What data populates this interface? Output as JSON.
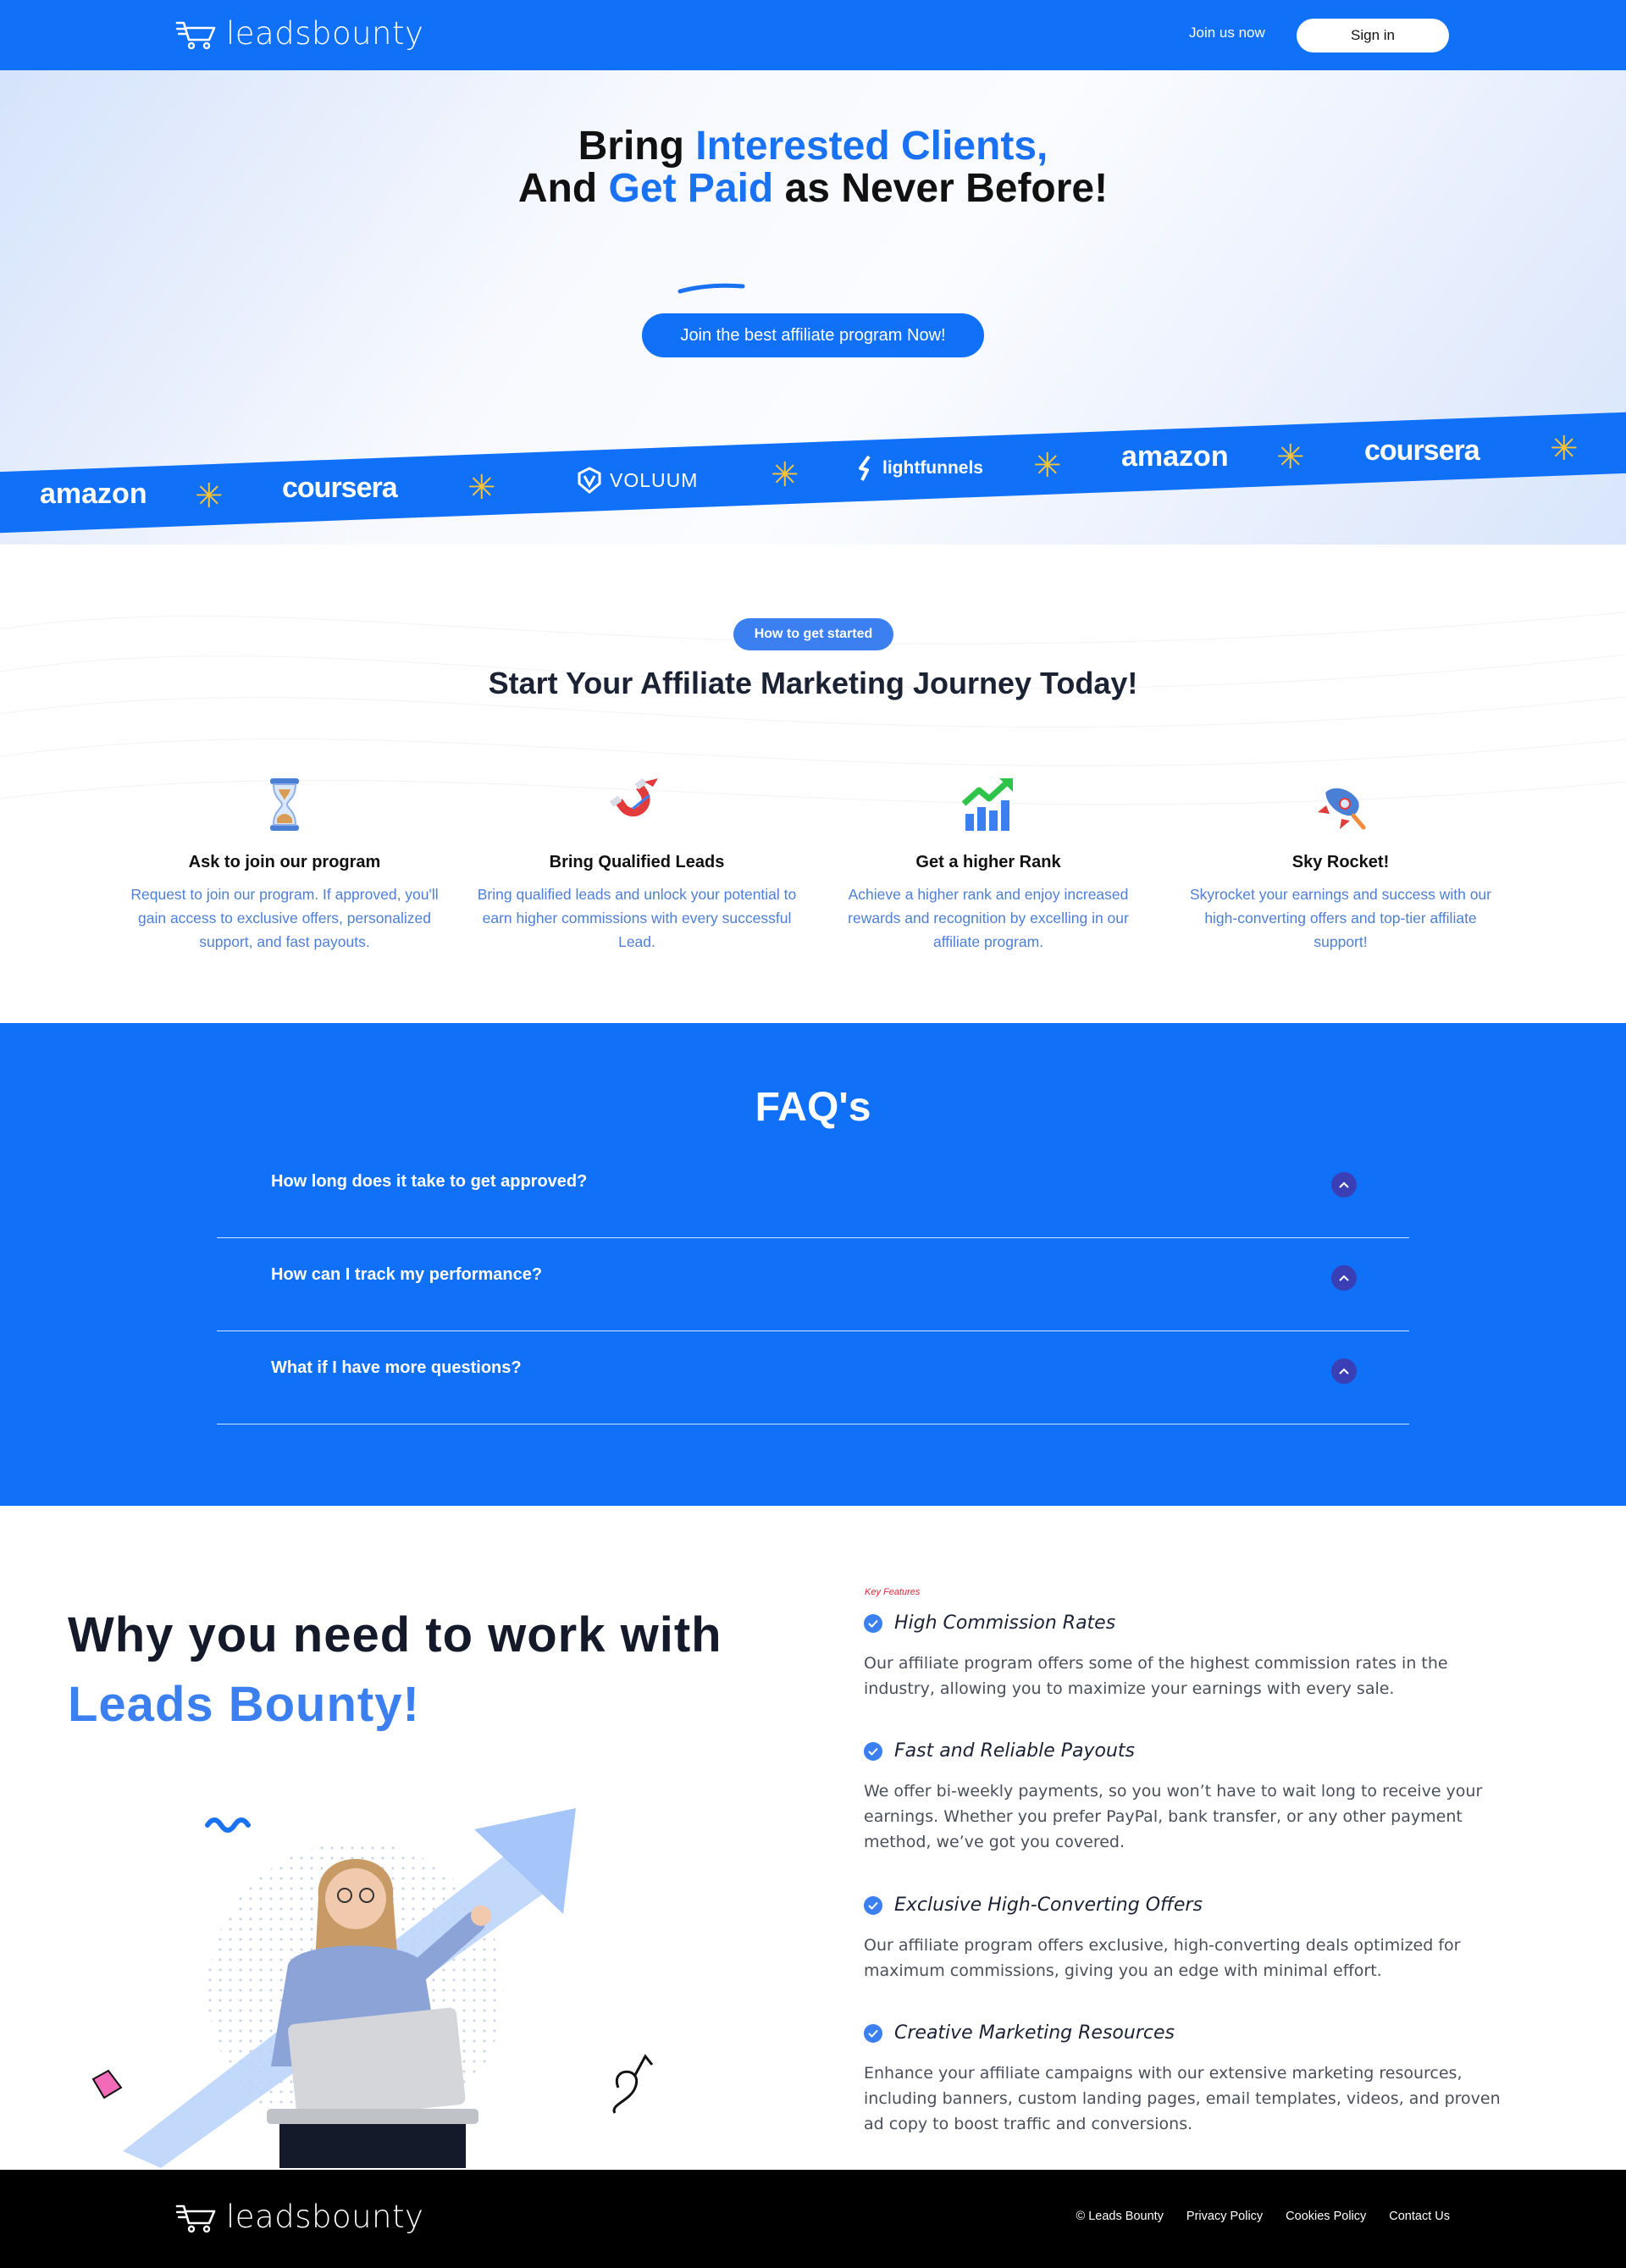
{
  "header": {
    "logo_text": "leadsbounty",
    "join_label": "Join us now",
    "signin_label": "Sign in"
  },
  "hero": {
    "line1_plain": "Bring ",
    "line1_blue": "Interested Clients,",
    "line2_plain_a": "And ",
    "line2_blue": "Get Paid",
    "line2_plain_b": " as Never Before!",
    "cta_label": "Join the best affiliate program Now!"
  },
  "brands": [
    "amazon",
    "coursera",
    "VOLUUM",
    "lightfunnels",
    "amazon",
    "coursera"
  ],
  "journey": {
    "badge": "How to get started",
    "title": "Start Your Affiliate Marketing Journey Today!",
    "steps": [
      {
        "icon": "hourglass-icon",
        "title": "Ask to join our program",
        "desc": "Request to join our program. If approved, you'll gain access to exclusive offers, personalized support, and fast payouts."
      },
      {
        "icon": "magnet-icon",
        "title": "Bring Qualified Leads",
        "desc": "Bring qualified leads and unlock your potential to earn higher commissions with every successful Lead."
      },
      {
        "icon": "growth-chart-icon",
        "title": "Get a higher Rank",
        "desc": "Achieve a higher rank and enjoy increased rewards and recognition by excelling in our affiliate program."
      },
      {
        "icon": "rocket-icon",
        "title": "Sky Rocket!",
        "desc": "Skyrocket your earnings and success with our high-converting offers and top-tier affiliate support!"
      }
    ]
  },
  "faq": {
    "title": "FAQ's",
    "items": [
      {
        "question": "How long does it take to get approved?"
      },
      {
        "question": "How can I track my performance?"
      },
      {
        "question": "What if I have more questions?"
      }
    ]
  },
  "why": {
    "title_line1": "Why you need to work with",
    "title_line2": "Leads Bounty!",
    "key_label": "Key Features",
    "features": [
      {
        "title": "High Commission Rates",
        "desc": "Our affiliate program offers some of the highest commission rates in the industry, allowing you to maximize your earnings with every sale."
      },
      {
        "title": "Fast and Reliable Payouts",
        "desc": "We offer bi-weekly payments, so you won’t have to wait long to receive your earnings. Whether you prefer PayPal, bank transfer, or any other payment method, we’ve got you covered."
      },
      {
        "title": "Exclusive High-Converting Offers",
        "desc": "Our affiliate program offers exclusive, high-converting deals optimized for maximum commissions, giving you an edge with minimal effort."
      },
      {
        "title": "Creative Marketing Resources",
        "desc": "Enhance your affiliate campaigns with our extensive marketing resources, including banners, custom landing pages, email templates, videos, and proven ad copy to boost traffic and conversions."
      }
    ]
  },
  "footer": {
    "logo_text": "leadsbounty",
    "links": [
      "© Leads Bounty",
      "Privacy Policy",
      "Cookies Policy",
      "Contact Us"
    ]
  },
  "colors": {
    "brand_blue": "#1070f8",
    "accent_blue": "#3b7ff0",
    "star_yellow": "#f6c33a",
    "footer_bg": "#000000"
  }
}
